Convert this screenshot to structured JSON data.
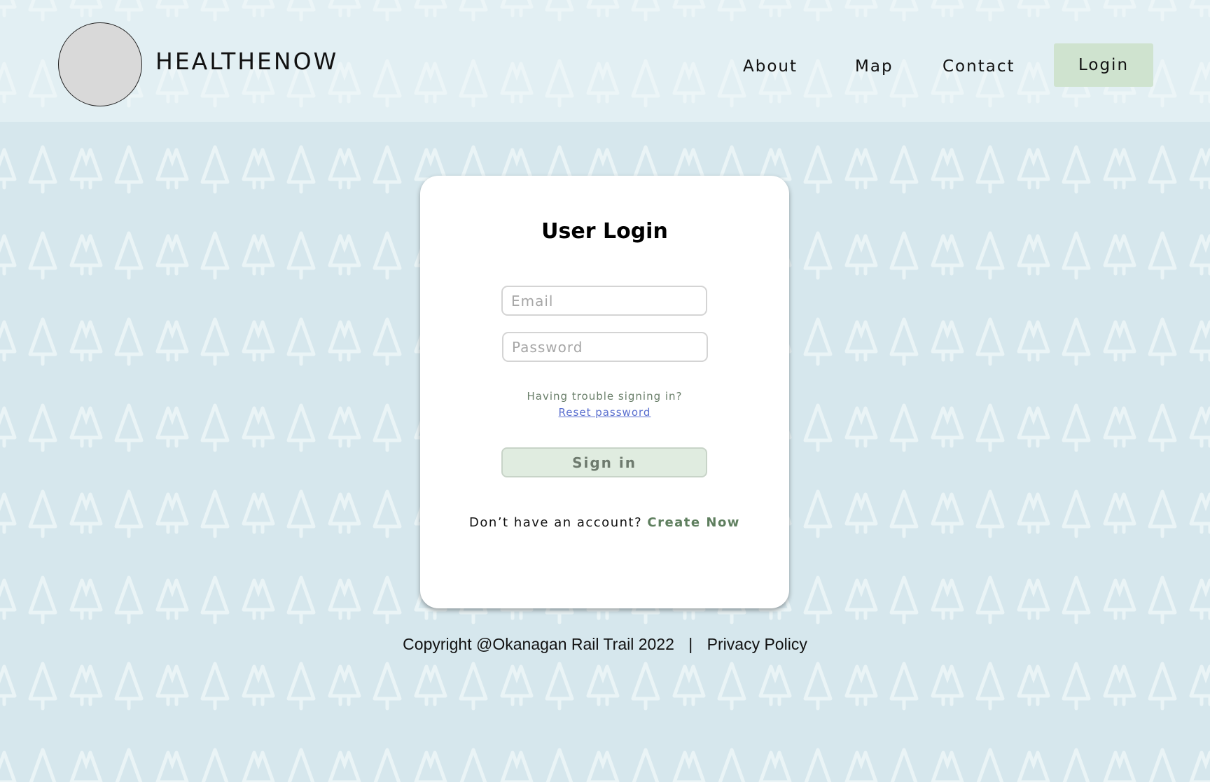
{
  "header": {
    "brand": "HEALTHENOW",
    "nav": {
      "about": "About",
      "map": "Map",
      "contact": "Contact",
      "login": "Login"
    }
  },
  "login_card": {
    "title": "User Login",
    "email_placeholder": "Email",
    "password_placeholder": "Password",
    "trouble_text": "Having trouble signing in?",
    "reset_link": "Reset password",
    "signin_button": "Sign in",
    "no_account_text": "Don’t have an account?",
    "create_now": "Create Now"
  },
  "footer": {
    "copyright": "Copyright @Okanagan Rail Trail 2022",
    "separator": "|",
    "privacy": "Privacy Policy"
  },
  "colors": {
    "background": "#d6e7ed",
    "nav_login_bg": "#cfe3cf",
    "signin_bg": "#e0ece0",
    "create_now": "#5f7f5f",
    "reset_link": "#5a6fcf"
  },
  "icons": {
    "logo": "logo-placeholder-circle",
    "background": "tree-pattern"
  }
}
